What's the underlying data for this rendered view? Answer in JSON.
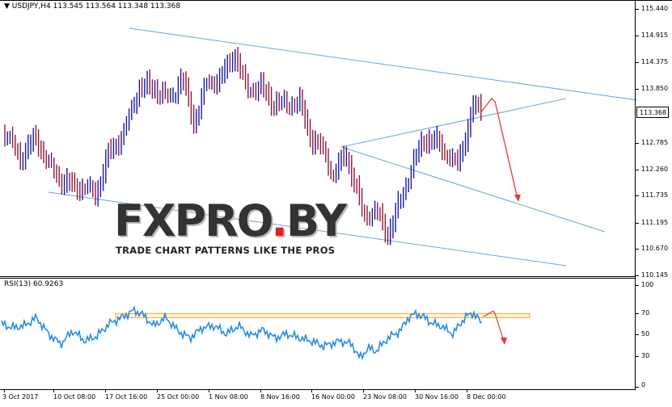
{
  "header": {
    "title": "USDJPY,H4",
    "ohlc": "113.545 113.564 113.348 113.368"
  },
  "price_axis": {
    "ticks": [
      "115.440",
      "114.915",
      "114.375",
      "113.850",
      "113.368",
      "112.785",
      "112.260",
      "111.735",
      "111.195",
      "110.670",
      "110.145"
    ],
    "current": "113.368"
  },
  "rsi": {
    "label": "RSI(13) 60.9263",
    "levels": [
      "100",
      "70",
      "50",
      "30",
      "0"
    ]
  },
  "time_axis": {
    "labels": [
      "3 Oct 2017",
      "10 Oct 08:00",
      "17 Oct 16:00",
      "25 Oct 00:00",
      "1 Nov 08:00",
      "8 Nov 16:00",
      "16 Nov 00:00",
      "23 Nov 08:00",
      "30 Nov 16:00",
      "8 Dec 00:00"
    ]
  },
  "watermark": {
    "brand_part1": "FXPRO",
    "brand_dot": ".",
    "brand_part2": "BY",
    "tagline": "TRADE CHART PATTERNS LIKE THE PROS"
  },
  "colors": {
    "bull": "#1a1aa0",
    "bear": "#8b1a3a",
    "trendline": "#6aa6d8",
    "rsi_line": "#1e88e5",
    "arrow": "#e53935",
    "rsi_zone": "#f5a623"
  },
  "chart_data": {
    "type": "line",
    "symbol": "USDJPY",
    "timeframe": "H4",
    "y_range": [
      110.145,
      115.44
    ],
    "x": [
      "3 Oct 2017",
      "10 Oct 08:00",
      "17 Oct 16:00",
      "25 Oct 00:00",
      "1 Nov 08:00",
      "8 Nov 16:00",
      "16 Nov 00:00",
      "23 Nov 08:00",
      "30 Nov 16:00",
      "8 Dec 00:00"
    ],
    "series": [
      {
        "name": "USDJPY,H4",
        "values": [
          112.8,
          111.9,
          113.2,
          114.2,
          114.5,
          113.6,
          112.1,
          111.1,
          112.8,
          113.4
        ]
      },
      {
        "name": "RSI(13)",
        "values": [
          55,
          40,
          60,
          70,
          65,
          50,
          40,
          30,
          65,
          61
        ]
      }
    ]
  }
}
